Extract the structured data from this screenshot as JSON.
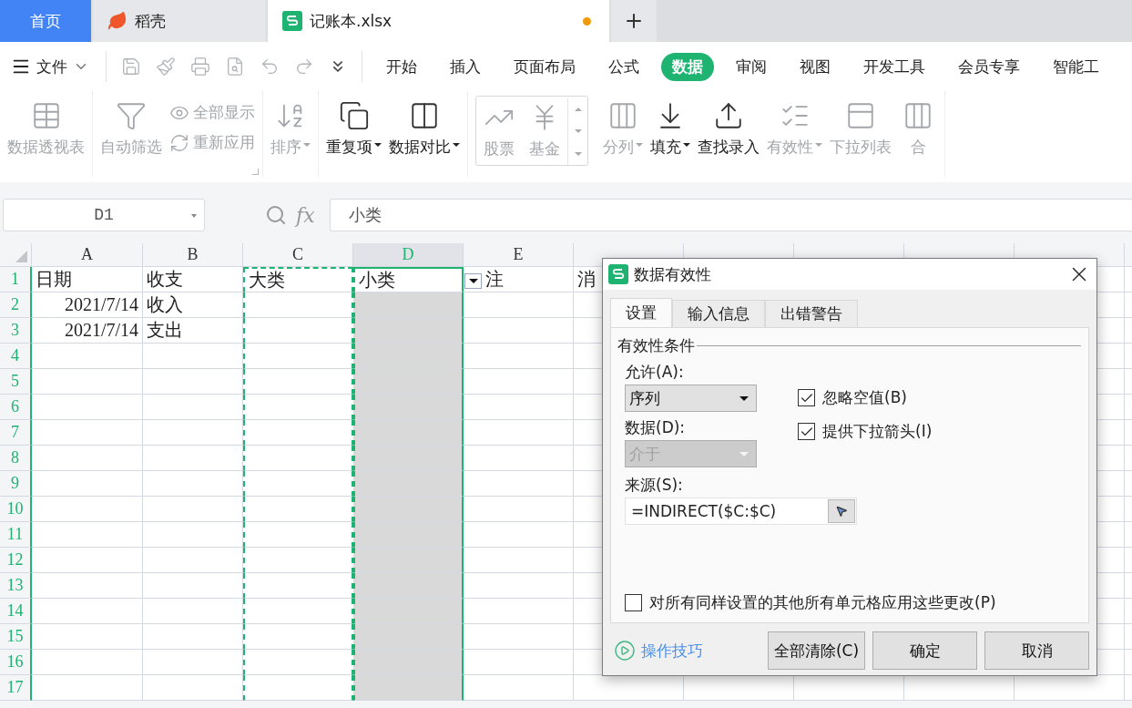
{
  "tabs": [
    {
      "label": "首页",
      "kind": "home",
      "selected": false
    },
    {
      "label": "稻壳",
      "kind": "docer",
      "selected": false
    },
    {
      "label": "记账本.xlsx",
      "kind": "sheet",
      "selected": true,
      "unsaved": true
    }
  ],
  "menu": {
    "file": "文件",
    "tabs": [
      {
        "label": "开始",
        "selected": false
      },
      {
        "label": "插入",
        "selected": false
      },
      {
        "label": "页面布局",
        "selected": false
      },
      {
        "label": "公式",
        "selected": false
      },
      {
        "label": "数据",
        "selected": true
      },
      {
        "label": "审阅",
        "selected": false
      },
      {
        "label": "视图",
        "selected": false
      },
      {
        "label": "开发工具",
        "selected": false
      },
      {
        "label": "会员专享",
        "selected": false
      },
      {
        "label": "智能工",
        "selected": false
      }
    ]
  },
  "ribbon": {
    "groups": [
      {
        "kind": "buttons",
        "launcher": false,
        "items": [
          {
            "kind": "large",
            "label": "数据透视表",
            "disabled": true,
            "dropdown": false
          }
        ]
      },
      {
        "kind": "buttons",
        "launcher": true,
        "items": [
          {
            "kind": "large",
            "label": "自动筛选",
            "disabled": true,
            "dropdown": false
          },
          {
            "kind": "stack",
            "items": [
              {
                "label": "全部显示",
                "disabled": true
              },
              {
                "label": "重新应用",
                "disabled": true
              }
            ]
          }
        ]
      },
      {
        "kind": "buttons",
        "launcher": false,
        "items": [
          {
            "kind": "large",
            "label": "排序",
            "disabled": true,
            "dropdown": true
          }
        ]
      },
      {
        "kind": "buttons",
        "launcher": false,
        "items": [
          {
            "kind": "large",
            "label": "重复项",
            "disabled": false,
            "dropdown": true
          },
          {
            "kind": "large",
            "label": "数据对比",
            "disabled": false,
            "dropdown": true
          }
        ]
      },
      {
        "kind": "gallery",
        "items": [
          {
            "kind": "large",
            "label": "股票",
            "disabled": true,
            "dropdown": false
          },
          {
            "kind": "large",
            "label": "基金",
            "disabled": true,
            "dropdown": false
          }
        ]
      },
      {
        "kind": "buttons",
        "launcher": false,
        "items": [
          {
            "kind": "large",
            "label": "分列",
            "disabled": true,
            "dropdown": true
          },
          {
            "kind": "large",
            "label": "填充",
            "disabled": false,
            "dropdown": true
          },
          {
            "kind": "large",
            "label": "查找录入",
            "disabled": false,
            "dropdown": false
          },
          {
            "kind": "large",
            "label": "有效性",
            "disabled": true,
            "dropdown": true
          },
          {
            "kind": "large",
            "label": "下拉列表",
            "disabled": true,
            "dropdown": false
          },
          {
            "kind": "large",
            "label": "合",
            "disabled": true,
            "dropdown": false
          }
        ]
      }
    ]
  },
  "formula_bar": {
    "name_box": "D1",
    "function_label": "fx",
    "formula": "小类"
  },
  "sheet": {
    "columns": [
      {
        "label": "A",
        "selected": false,
        "copy_marquee": false
      },
      {
        "label": "B",
        "selected": false,
        "copy_marquee": false
      },
      {
        "label": "C",
        "selected": false,
        "copy_marquee": true
      },
      {
        "label": "D",
        "selected": true,
        "copy_marquee": true
      },
      {
        "label": "E",
        "selected": false,
        "copy_marquee": false
      },
      {
        "selected": false,
        "copy_marquee": false
      },
      {
        "selected": false,
        "copy_marquee": false
      },
      {
        "selected": false,
        "copy_marquee": false
      },
      {
        "selected": false,
        "copy_marquee": false
      },
      {
        "selected": false,
        "copy_marquee": false
      }
    ],
    "rows": [
      {
        "number": "1",
        "active": true,
        "cells": [
          "日期",
          "收支",
          "大类",
          "小类",
          "注",
          "消"
        ]
      },
      {
        "number": "2",
        "active": false,
        "cells": [
          "2021/7/14",
          "收入"
        ]
      },
      {
        "number": "3",
        "active": false,
        "cells": [
          "2021/7/14",
          "支出"
        ]
      },
      {
        "number": "4",
        "active": false
      },
      {
        "number": "5",
        "active": false
      },
      {
        "number": "6",
        "active": false
      },
      {
        "number": "7",
        "active": false
      },
      {
        "number": "8",
        "active": false
      },
      {
        "number": "9",
        "active": false
      },
      {
        "number": "10",
        "active": false
      },
      {
        "number": "11",
        "active": false
      },
      {
        "number": "12",
        "active": false
      },
      {
        "number": "13",
        "active": false
      },
      {
        "number": "14",
        "active": false
      },
      {
        "number": "15",
        "active": false
      },
      {
        "number": "16",
        "active": false
      },
      {
        "number": "17",
        "active": false
      }
    ]
  },
  "dialog": {
    "title": "数据有效性",
    "tabs": [
      {
        "label": "设置",
        "selected": true
      },
      {
        "label": "输入信息",
        "selected": false
      },
      {
        "label": "出错警告",
        "selected": false
      }
    ],
    "group_title": "有效性条件",
    "allow": {
      "label": "允许(A):",
      "value": "序列",
      "disabled": false
    },
    "data": {
      "label": "数据(D):",
      "value": "介于",
      "disabled": true
    },
    "checkboxes": [
      {
        "label": "忽略空值(B)",
        "checked": true
      },
      {
        "label": "提供下拉箭头(I)",
        "checked": true
      }
    ],
    "source": {
      "label": "来源(S):",
      "value": "=INDIRECT($C:$C)"
    },
    "apply_all": {
      "label": "对所有同样设置的其他所有单元格应用这些更改(P)",
      "checked": false
    },
    "tips_link": "操作技巧",
    "buttons": [
      "全部清除(C)",
      "确定",
      "取消"
    ]
  }
}
